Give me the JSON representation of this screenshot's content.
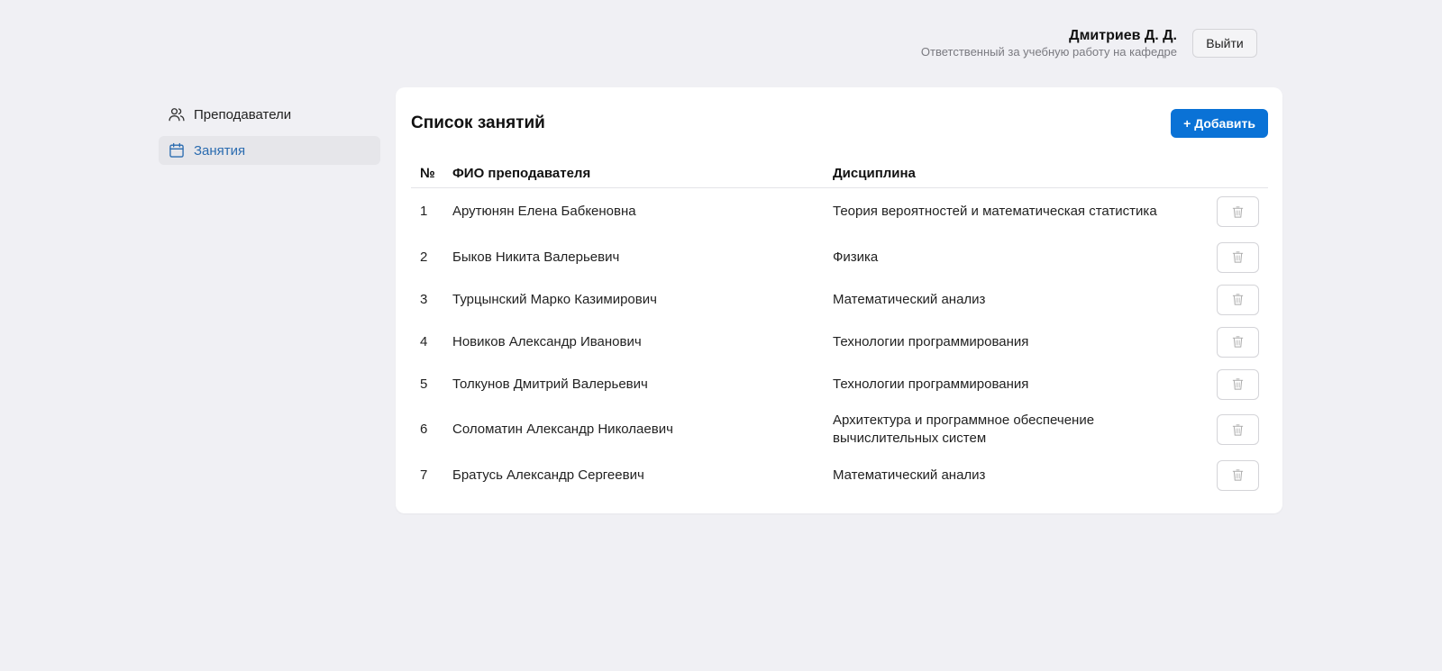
{
  "header": {
    "user_name": "Дмитриев Д. Д.",
    "user_role": "Ответственный за учебную работу на кафедре",
    "logout_label": "Выйти"
  },
  "sidebar": {
    "items": [
      {
        "label": "Преподаватели",
        "icon": "users-icon",
        "active": false
      },
      {
        "label": "Занятия",
        "icon": "calendar-icon",
        "active": true
      }
    ]
  },
  "main": {
    "title": "Список занятий",
    "add_label": "+ Добавить",
    "columns": {
      "num": "№",
      "name": "ФИО преподавателя",
      "discipline": "Дисциплина"
    },
    "rows": [
      {
        "num": "1",
        "name": "Арутюнян Елена Бабкеновна",
        "discipline": "Теория вероятностей и математическая статистика"
      },
      {
        "num": "2",
        "name": "Быков Никита Валерьевич",
        "discipline": "Физика"
      },
      {
        "num": "3",
        "name": "Турцынский Марко Казимирович",
        "discipline": "Математический анализ"
      },
      {
        "num": "4",
        "name": "Новиков Александр Иванович",
        "discipline": "Технологии программирования"
      },
      {
        "num": "5",
        "name": "Толкунов Дмитрий Валерьевич",
        "discipline": "Технологии программирования"
      },
      {
        "num": "6",
        "name": "Соломатин Александр Николаевич",
        "discipline": "Архитектура и программное обеспечение вычислительных систем"
      },
      {
        "num": "7",
        "name": "Братусь Александр Сергеевич",
        "discipline": "Математический анализ"
      }
    ],
    "delete_icon": "trash-icon"
  },
  "colors": {
    "background": "#f0f0f4",
    "accent": "#0a72d6",
    "active_nav_text": "#2b6cb0"
  }
}
